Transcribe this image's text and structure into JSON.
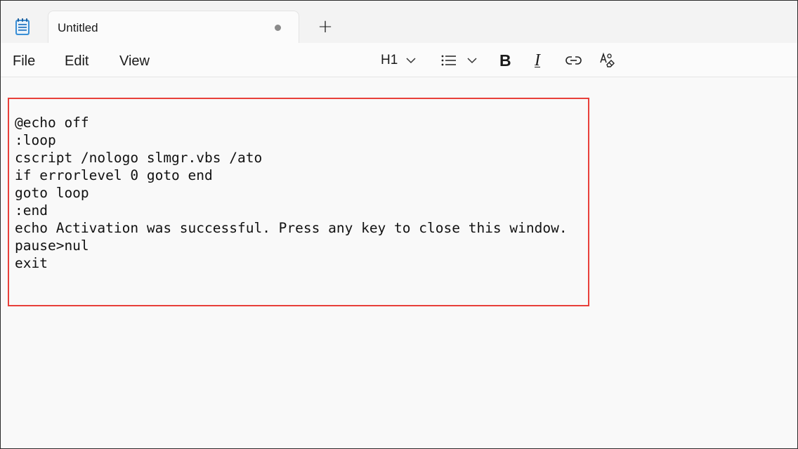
{
  "tab": {
    "title": "Untitled",
    "new_tab_label": "+"
  },
  "menu": {
    "file": "File",
    "edit": "Edit",
    "view": "View"
  },
  "toolbar": {
    "heading": "H1",
    "bold_glyph": "B",
    "italic_glyph": "I",
    "icons": [
      "chevron-down-icon",
      "list-icon",
      "link-icon",
      "clear-formatting-icon"
    ]
  },
  "editor": {
    "lines": [
      "@echo off",
      ":loop",
      "cscript /nologo slmgr.vbs /ato",
      "if errorlevel 0 goto end",
      "goto loop",
      ":end",
      "echo Activation was successful. Press any key to close this window.",
      "pause>nul",
      "exit"
    ]
  },
  "colors": {
    "highlight_border": "#e8403a",
    "app_icon_blue": "#2b79c2",
    "app_icon_teal": "#4ab3c8"
  }
}
